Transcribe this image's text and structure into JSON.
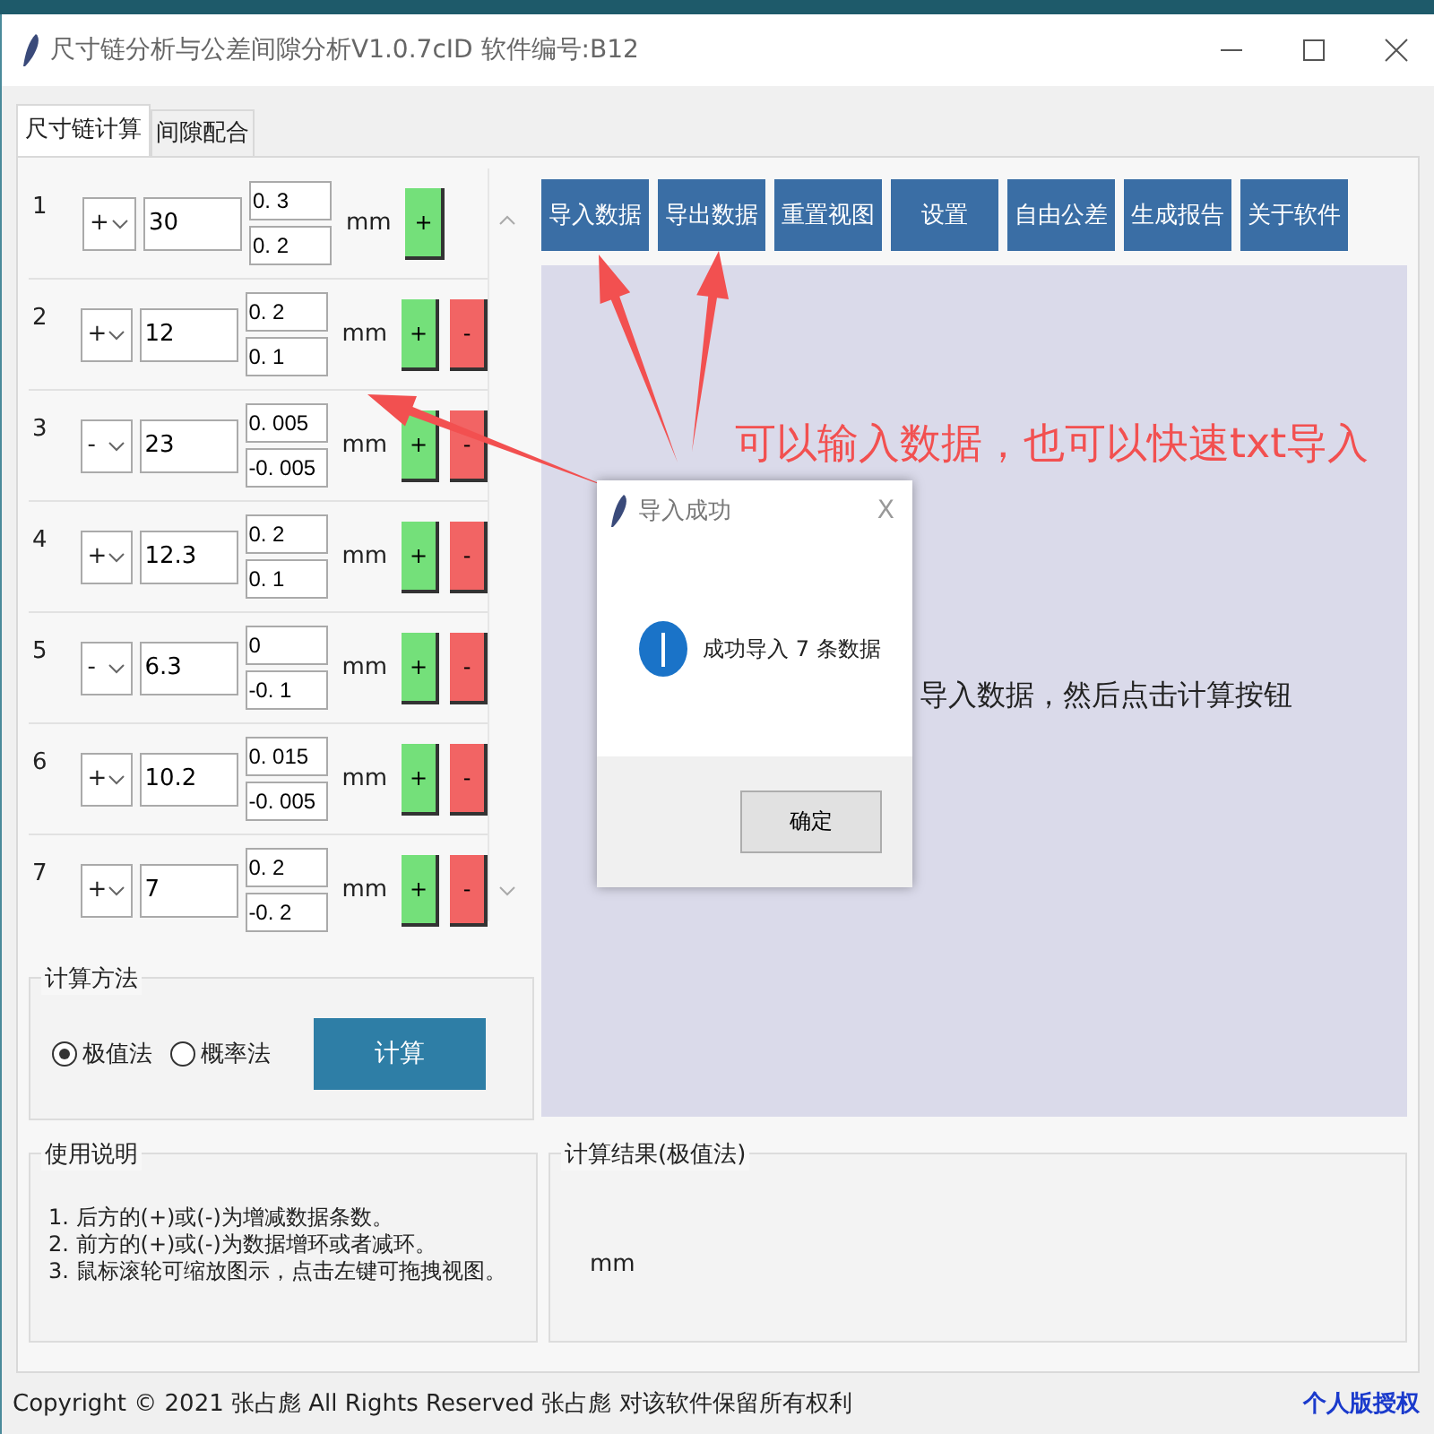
{
  "window": {
    "title": "尺寸链分析与公差间隙分析V1.0.7cID 软件编号:B12"
  },
  "tabs": [
    {
      "label": "尺寸链计算",
      "selected": true
    },
    {
      "label": "间隙配合",
      "selected": false
    }
  ],
  "rows": [
    {
      "index": "1",
      "sign": "+",
      "value": "30",
      "upper": "0. 3",
      "lower": "0. 2",
      "unit": "mm",
      "add": "+",
      "remove": null
    },
    {
      "index": "2",
      "sign": "+",
      "value": "12",
      "upper": "0. 2",
      "lower": "0. 1",
      "unit": "mm",
      "add": "+",
      "remove": "-"
    },
    {
      "index": "3",
      "sign": "-",
      "value": "23",
      "upper": "0. 005",
      "lower": "-0. 005",
      "unit": "mm",
      "add": "+",
      "remove": "-"
    },
    {
      "index": "4",
      "sign": "+",
      "value": "12.3",
      "upper": "0. 2",
      "lower": "0. 1",
      "unit": "mm",
      "add": "+",
      "remove": "-"
    },
    {
      "index": "5",
      "sign": "-",
      "value": "6.3",
      "upper": "0",
      "lower": "-0. 1",
      "unit": "mm",
      "add": "+",
      "remove": "-"
    },
    {
      "index": "6",
      "sign": "+",
      "value": "10.2",
      "upper": "0. 015",
      "lower": "-0. 005",
      "unit": "mm",
      "add": "+",
      "remove": "-"
    },
    {
      "index": "7",
      "sign": "+",
      "value": "7",
      "upper": "0. 2",
      "lower": "-0. 2",
      "unit": "mm",
      "add": "+",
      "remove": "-"
    }
  ],
  "toolbar": [
    "导入数据",
    "导出数据",
    "重置视图",
    "设置",
    "自由公差",
    "生成报告",
    "关于软件"
  ],
  "canvas": {
    "hint": "导入数据，然后点击计算按钮"
  },
  "method": {
    "title": "计算方法",
    "options": [
      {
        "label": "极值法",
        "selected": true
      },
      {
        "label": "概率法",
        "selected": false
      }
    ],
    "button": "计算"
  },
  "instructions": {
    "title": "使用说明",
    "lines": [
      "1. 后方的(+)或(-)为增减数据条数。",
      "2. 前方的(+)或(-)为数据增环或者减环。",
      "3. 鼠标滚轮可缩放图示，点击左键可拖拽视图。"
    ]
  },
  "result": {
    "title": "计算结果(极值法)",
    "unit": "mm"
  },
  "footer": {
    "copyright": "Copyright © 2021 张占彪 All Rights Reserved 张占彪 对该软件保留所有权利",
    "license": "个人版授权"
  },
  "annotation": {
    "text": "可以输入数据，也可以快速txt导入"
  },
  "dialog": {
    "title": "导入成功",
    "close": "X",
    "message": "成功导入 7 条数据",
    "button": "确定"
  }
}
